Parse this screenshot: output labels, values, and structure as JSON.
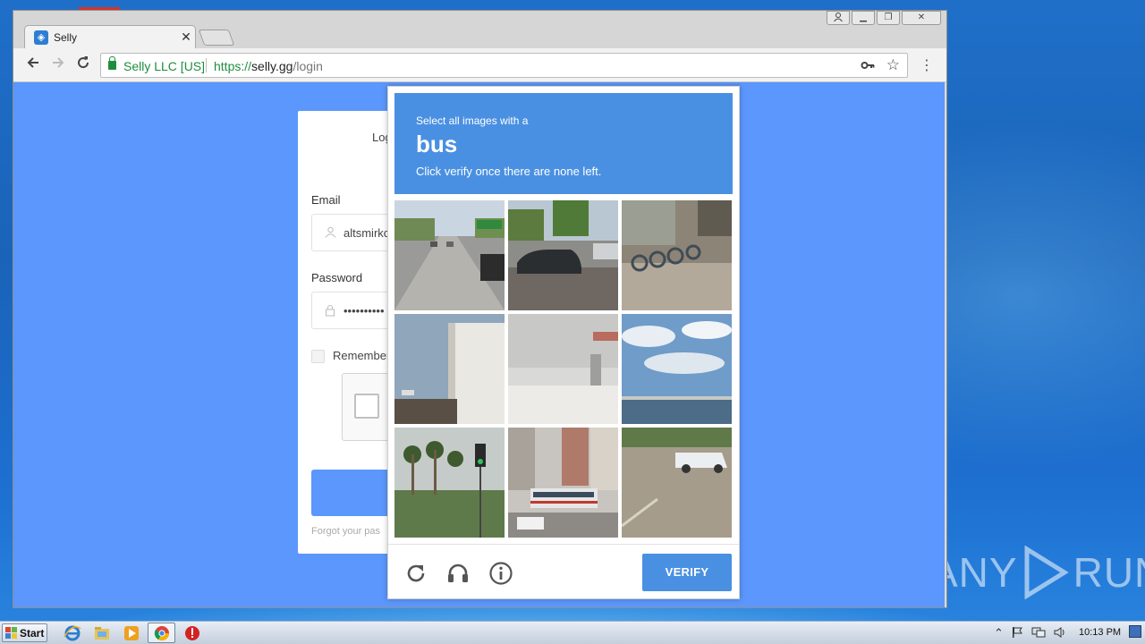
{
  "browser": {
    "tab_title": "Selly",
    "tab_close": "✕",
    "site_identity": "Selly LLC [US]",
    "url_scheme": "https://",
    "url_host": "selly.gg",
    "url_path": "/login",
    "icons": [
      "back-icon",
      "forward-icon",
      "reload-icon",
      "lock-icon",
      "key-icon",
      "star-icon",
      "menu-icon"
    ]
  },
  "login": {
    "title": "Log",
    "email_label": "Email",
    "email_value": "altsmirko",
    "password_label": "Password",
    "password_value": "••••••••••",
    "remember_label": "Remember",
    "forgot_label": "Forgot your pas"
  },
  "challenge": {
    "line1": "Select all images with a",
    "target": "bus",
    "line2": "Click verify once there are none left.",
    "verify_label": "VERIFY",
    "tiles": [
      "highway-traffic",
      "parked-car-street",
      "bike-rack",
      "house-roof",
      "blurred-storefront",
      "sky-waterfront",
      "palm-trees-traffic-light",
      "city-bus-street",
      "parking-lot-suv"
    ]
  },
  "watermark": {
    "left": "ANY",
    "right": "RUN"
  },
  "taskbar": {
    "start_label": "Start",
    "clock": "10:13 PM"
  },
  "colors": {
    "page_bg": "#5b97fc",
    "recaptcha_blue": "#4a90e2",
    "secure_green": "#1e8e3e"
  }
}
